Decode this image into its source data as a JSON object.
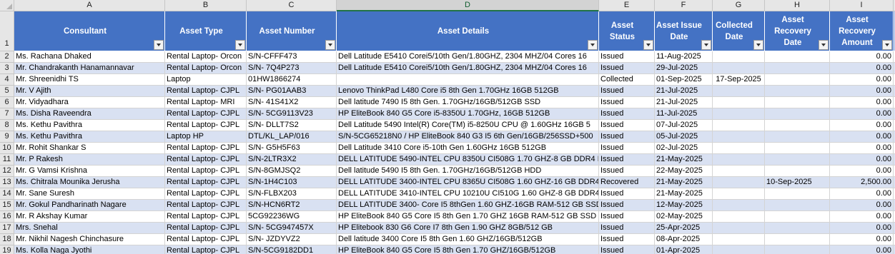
{
  "columns": [
    "A",
    "B",
    "C",
    "D",
    "E",
    "F",
    "G",
    "H",
    "I"
  ],
  "active_column": "D",
  "header_row_number": "1",
  "headers": [
    "Consultant",
    "Asset Type",
    "Asset Number",
    "Asset Details",
    "Asset Status",
    "Asset Issue Date",
    "Collected Date",
    "Asset Recovery Date",
    "Asset Recovery Amount"
  ],
  "rows": [
    {
      "num": "2",
      "consultant": "Ms. Rachana Dhaked",
      "type": "Rental Laptop- Orcon",
      "number": "S/N-CFFF473",
      "details": "Dell Latitude E5410 Corei5/10th Gen/1.80GHZ, 2304 MHZ/04 Cores 16",
      "status": "Issued",
      "issue": "11-Aug-2025",
      "collected": "",
      "recovery_date": "",
      "amount": "0.00"
    },
    {
      "num": "3",
      "consultant": "Mr. Chandrakanth Hanamannavar",
      "type": "Rental Laptop- Orcon",
      "number": "S/N- 7Q4P273",
      "details": "Dell Latitude E5410 Corei5/10th Gen/1.80GHZ, 2304 MHZ/04 Cores 16",
      "status": "Issued",
      "issue": "29-Jul-2025",
      "collected": "",
      "recovery_date": "",
      "amount": "0.00"
    },
    {
      "num": "4",
      "consultant": "Mr. Shreenidhi TS",
      "type": "Laptop",
      "number": "01HW1866274",
      "details": "",
      "status": "Collected",
      "issue": "01-Sep-2025",
      "collected": "17-Sep-2025",
      "recovery_date": "",
      "amount": "0.00"
    },
    {
      "num": "5",
      "consultant": "Mr. V Ajith",
      "type": "Rental Laptop- CJPL",
      "number": "S/N- PG01AAB3",
      "details": "Lenovo ThinkPad L480 Core i5 8th Gen 1.70GHz 16GB 512GB",
      "status": "Issued",
      "issue": "21-Jul-2025",
      "collected": "",
      "recovery_date": "",
      "amount": "0.00"
    },
    {
      "num": "6",
      "consultant": "Mr. Vidyadhara",
      "type": "Rental Laptop- MRI",
      "number": "S/N- 41S41X2",
      "details": "Dell latitude 7490 I5 8th Gen. 1.70GHz/16GB/512GB SSD",
      "status": "Issued",
      "issue": "21-Jul-2025",
      "collected": "",
      "recovery_date": "",
      "amount": "0.00"
    },
    {
      "num": "7",
      "consultant": "Ms. Disha Raveendra",
      "type": "Rental Laptop- CJPL",
      "number": "S/N- 5CG9113V23",
      "details": "HP EliteBook 840 G5 Core i5-8350U 1.70GHz, 16GB 512GB",
      "status": "Issued",
      "issue": "11-Jul-2025",
      "collected": "",
      "recovery_date": "",
      "amount": "0.00"
    },
    {
      "num": "8",
      "consultant": "Ms. Kethu Pavithra",
      "type": "Rental Laptop- CJPL",
      "number": "S/N- DLLT7S2",
      "details": "Dell Latitude 5490 Intel(R) Core(TM) i5-8250U CPU @ 1.60GHz  16GB 5",
      "status": "Issued",
      "issue": "07-Jul-2025",
      "collected": "",
      "recovery_date": "",
      "amount": "0.00"
    },
    {
      "num": "9",
      "consultant": "Ms. Kethu Pavithra",
      "type": "Laptop HP",
      "number": "DTL/KL_LAP/016",
      "details": "S/N-5CG65218N0 / HP EliteBook 840 G3 I5 6th Gen/16GB/256SSD+500",
      "status": "Issued",
      "issue": "05-Jul-2025",
      "collected": "",
      "recovery_date": "",
      "amount": "0.00"
    },
    {
      "num": "10",
      "consultant": "Mr. Rohit Shankar S",
      "type": "Rental Laptop- CJPL",
      "number": "S/N- G5H5F63",
      "details": "Dell Latitude 3410 Core i5-10th Gen 1.60GHz 16GB 512GB",
      "status": "Issued",
      "issue": "02-Jul-2025",
      "collected": "",
      "recovery_date": "",
      "amount": "0.00"
    },
    {
      "num": "11",
      "consultant": "Mr. P Rakesh",
      "type": "Rental Laptop- CJPL",
      "number": "S/N-2LTR3X2",
      "details": "DELL LATITUDE 5490-INTEL CPU 8350U CI508G 1.70 GHZ-8 GB DDR4 RAI",
      "status": "Issued",
      "issue": "21-May-2025",
      "collected": "",
      "recovery_date": "",
      "amount": "0.00"
    },
    {
      "num": "12",
      "consultant": "Mr. G Vamsi Krishna",
      "type": "Rental Laptop- CJPL",
      "number": "S/N-8GMJSQ2",
      "details": "Dell latitude 5490 I5 8th Gen. 1.70GHz/16GB/512GB HDD",
      "status": "Issued",
      "issue": "22-May-2025",
      "collected": "",
      "recovery_date": "",
      "amount": "0.00"
    },
    {
      "num": "13",
      "consultant": "Ms. Chitrala Mounika Jerusha",
      "type": "Rental Laptop- CJPL",
      "number": "S/N-1H4C103",
      "details": "DELL LATITUDE 3400-INTEL CPU 8365U CI508G 1.60 GHZ-16 GB DDR4 RA",
      "status": "Recovered",
      "issue": "21-May-2025",
      "collected": "",
      "recovery_date": "10-Sep-2025",
      "amount": "2,500.00"
    },
    {
      "num": "14",
      "consultant": "Mr. Sane Suresh",
      "type": "Rental Laptop- CJPL",
      "number": "S/N-FLBX203",
      "details": "DELL LATITUDE 3410-INTEL CPU 10210U CI510G 1.60 GHZ-8 GB DDR4 RA",
      "status": "Issued",
      "issue": "21-May-2025",
      "collected": "",
      "recovery_date": "",
      "amount": "0.00"
    },
    {
      "num": "15",
      "consultant": "Mr. Gokul Pandharinath Nagare",
      "type": "Rental Laptop- CJPL",
      "number": "S/N-HCN6RT2",
      "details": "DELL LATITUDE 3400- Core I5 8thGen 1.60 GHZ-16GB RAM-512 GB SSD",
      "status": "Issued",
      "issue": "12-May-2025",
      "collected": "",
      "recovery_date": "",
      "amount": "0.00"
    },
    {
      "num": "16",
      "consultant": "Mr. R Akshay Kumar",
      "type": "Rental Laptop- CJPL",
      "number": "5CG92236WG",
      "details": "HP EliteBook 840 G5 Core I5 8th Gen 1.70 GHZ 16GB RAM-512 GB SSD",
      "status": "Issued",
      "issue": "02-May-2025",
      "collected": "",
      "recovery_date": "",
      "amount": "0.00"
    },
    {
      "num": "17",
      "consultant": "Mrs. Snehal",
      "type": "Rental Laptop- CJPL",
      "number": "S/N- 5CG947457X",
      "details": "HP Elitebook 830 G6 Core I7 8th Gen 1.90 GHZ 8GB/512 GB",
      "status": "Issued",
      "issue": "25-Apr-2025",
      "collected": "",
      "recovery_date": "",
      "amount": "0.00"
    },
    {
      "num": "18",
      "consultant": "Mr. Nikhil Nagesh Chinchasure",
      "type": "Rental Laptop- CJPL",
      "number": "S/N- JZDYVZ2",
      "details": "Dell latitude 3400 Core I5 8th Gen 1.60 GHZ/16GB/512GB",
      "status": "Issued",
      "issue": "08-Apr-2025",
      "collected": "",
      "recovery_date": "",
      "amount": "0.00"
    },
    {
      "num": "19",
      "consultant": "Ms. Kolla Naga Jyothi",
      "type": "Rental Laptop- CJPL",
      "number": "S/N-5CG9182DD1",
      "details": "HP EliteBook 840 G5 Core I5 8th Gen 1.70 GHZ/16GB/512GB",
      "status": "Issued",
      "issue": "01-Apr-2025",
      "collected": "",
      "recovery_date": "",
      "amount": "0.00"
    }
  ],
  "colors": {
    "header_fill": "#4472c4",
    "band_fill": "#d9e1f2",
    "active_column_accent": "#217346"
  },
  "icons": {
    "filter": "filter-dropdown-icon",
    "select_all": "select-all-corner"
  }
}
